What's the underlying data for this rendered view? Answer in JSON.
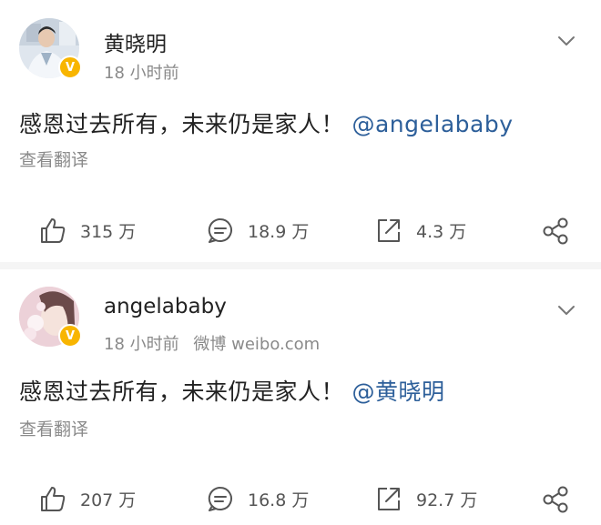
{
  "posts": [
    {
      "username": "黄晓明",
      "time": "18 小时前",
      "source": "",
      "text_main": "感恩过去所有，未来仍是家人！",
      "mention": "@angelababy",
      "translate_label": "查看翻译",
      "likes": "315 万",
      "comments": "18.9 万",
      "reposts": "4.3 万",
      "verified_mark": "V"
    },
    {
      "username": "angelababy",
      "time": "18 小时前",
      "source": "微博 weibo.com",
      "text_main": "感恩过去所有，未来仍是家人！",
      "mention": "@黄晓明",
      "translate_label": "查看翻译",
      "likes": "207 万",
      "comments": "16.8 万",
      "reposts": "92.7 万",
      "verified_mark": "V"
    }
  ],
  "colors": {
    "mention": "#2d5f9a",
    "meta": "#8a8a8a",
    "verified": "#f8b500",
    "icon": "#555555"
  }
}
